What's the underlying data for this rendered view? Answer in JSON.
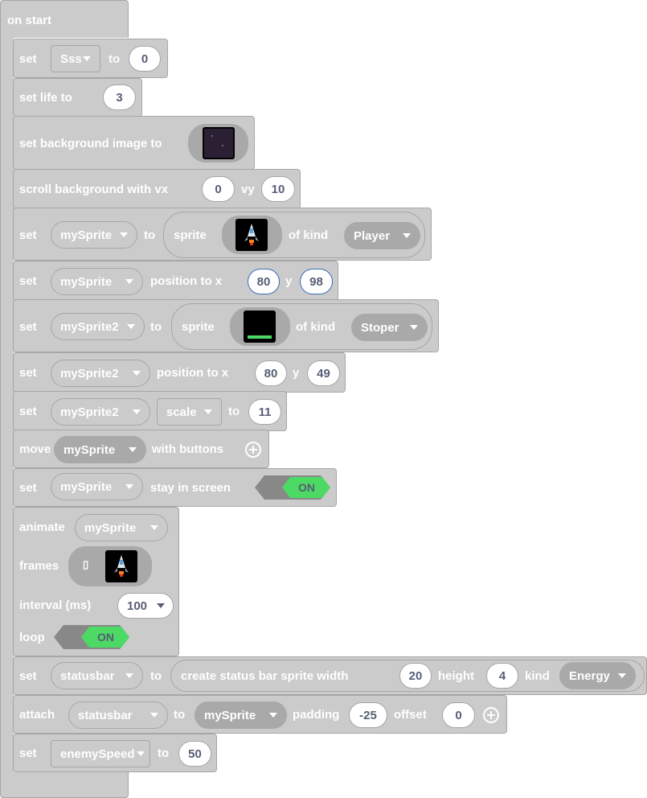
{
  "on_start": "on start",
  "b1": {
    "set": "set",
    "var": "Sss",
    "to": "to",
    "value": "0"
  },
  "b2": {
    "label": "set life to",
    "value": "3"
  },
  "b3": {
    "label": "set background image to"
  },
  "b4": {
    "label": "scroll background with vx",
    "vx": "0",
    "vy_label": "vy",
    "vy": "10"
  },
  "b5": {
    "set": "set",
    "var": "mySprite",
    "to": "to",
    "sprite": "sprite",
    "of_kind": "of kind",
    "kind": "Player"
  },
  "b6": {
    "set": "set",
    "var": "mySprite",
    "label": "position to x",
    "x": "80",
    "y_label": "y",
    "y": "98"
  },
  "b7": {
    "set": "set",
    "var": "mySprite2",
    "to": "to",
    "sprite": "sprite",
    "of_kind": "of kind",
    "kind": "Stoper"
  },
  "b8": {
    "set": "set",
    "var": "mySprite2",
    "label": "position to x",
    "x": "80",
    "y_label": "y",
    "y": "49"
  },
  "b9": {
    "set": "set",
    "var": "mySprite2",
    "prop": "scale",
    "to": "to",
    "value": "11"
  },
  "b10": {
    "move": "move",
    "var": "mySprite",
    "label": "with buttons"
  },
  "b11": {
    "set": "set",
    "var": "mySprite",
    "label": "stay in screen",
    "toggle": "ON"
  },
  "b12": {
    "animate": "animate",
    "var": "mySprite",
    "frames": "frames",
    "frame_placeholder": "▯",
    "interval_label": "interval (ms)",
    "interval": "100",
    "loop": "loop",
    "toggle": "ON"
  },
  "b13": {
    "set": "set",
    "var": "statusbar",
    "to": "to",
    "label": "create status bar sprite width",
    "width": "20",
    "height_label": "height",
    "height": "4",
    "kind_label": "kind",
    "kind": "Energy"
  },
  "b14": {
    "attach": "attach",
    "var": "statusbar",
    "to": "to",
    "target": "mySprite",
    "padding_label": "padding",
    "padding": "-25",
    "offset_label": "offset",
    "offset": "0"
  },
  "b15": {
    "set": "set",
    "var": "enemySpeed",
    "to": "to",
    "value": "50"
  },
  "colors": {
    "block": "#cbcbcb",
    "border": "#a6a6a6",
    "toggle_on": "#4cd964",
    "value_text": "#575e75"
  },
  "icons": [
    "rocket-sprite-icon",
    "green-bar-sprite-icon",
    "space-background-icon",
    "add-icon",
    "dropdown-caret-icon"
  ]
}
